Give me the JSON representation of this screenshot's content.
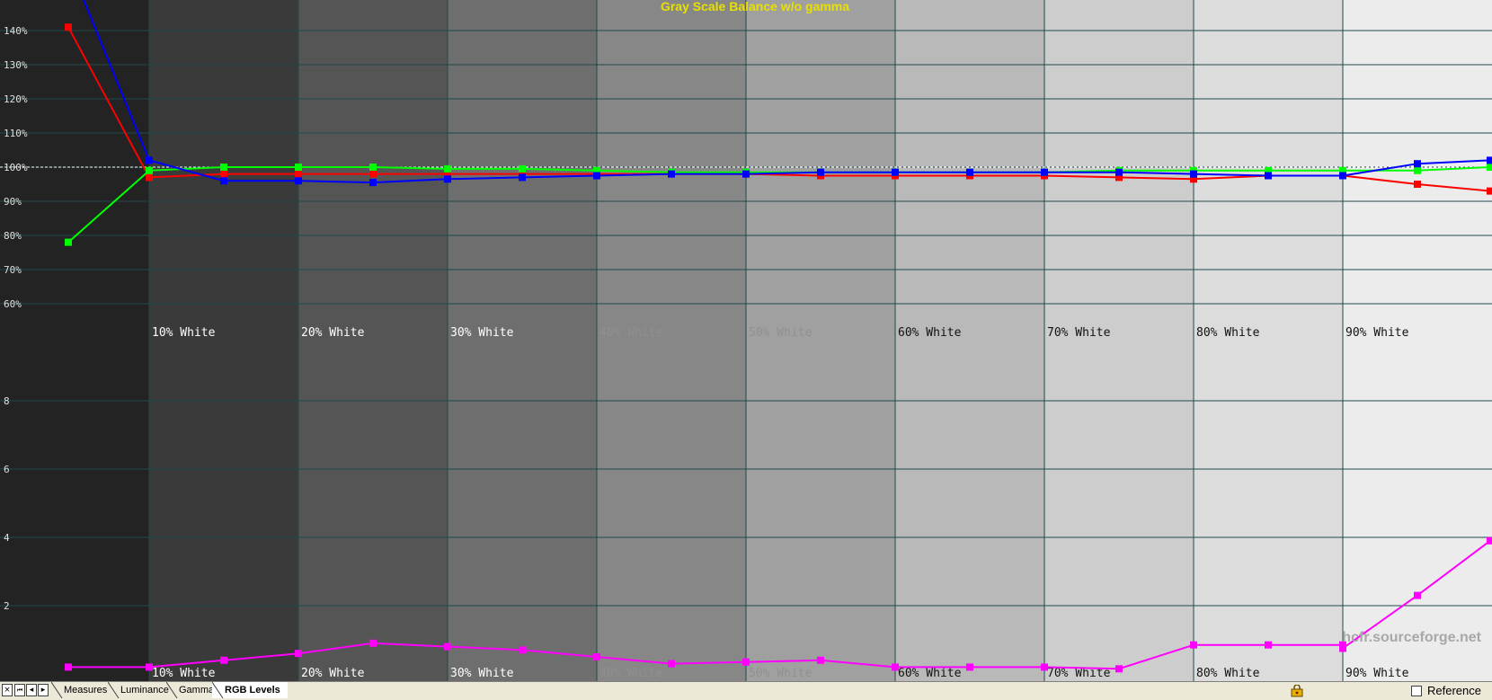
{
  "chart_data": {
    "type": "line",
    "title": "Gray Scale Balance w/o gamma",
    "x": [
      0,
      10,
      15,
      20,
      25,
      30,
      35,
      40,
      45,
      50,
      55,
      60,
      65,
      70,
      75,
      80,
      85,
      90,
      95,
      100
    ],
    "x_tick_labels": [
      "10% White",
      "20% White",
      "30% White",
      "40% White",
      "50% White",
      "60% White",
      "70% White",
      "80% White",
      "90% White"
    ],
    "upper_panel": {
      "y_tick_labels": [
        "60%",
        "70%",
        "80%",
        "90%",
        "100%",
        "110%",
        "120%",
        "130%",
        "140%"
      ],
      "ylim": [
        55,
        145
      ],
      "series": [
        {
          "color": "#ff0000",
          "values": [
            141,
            97,
            98,
            98,
            98,
            98,
            98,
            98,
            98,
            98,
            97.5,
            97.5,
            97.5,
            97.5,
            97,
            96.5,
            97.5,
            97.5,
            95,
            93
          ]
        },
        {
          "color": "#00ff00",
          "values": [
            78,
            99,
            100,
            100,
            100,
            99.5,
            99.5,
            99,
            98.5,
            98.5,
            98.5,
            98.5,
            98.5,
            98.5,
            99,
            99,
            99,
            99,
            99,
            100
          ]
        },
        {
          "color": "#0000ff",
          "values": [
            160,
            102,
            96,
            96,
            95.5,
            96.5,
            97,
            97.5,
            98,
            98,
            98.5,
            98.5,
            98.5,
            98.5,
            98.5,
            98,
            97.5,
            97.5,
            101,
            102
          ]
        }
      ]
    },
    "lower_panel": {
      "y_tick_labels": [
        "2",
        "4",
        "6",
        "8"
      ],
      "ylim": [
        0,
        10
      ],
      "series": [
        {
          "color": "#ff00ff",
          "values": [
            0.2,
            0.2,
            0.4,
            0.6,
            0.9,
            0.8,
            0.7,
            0.5,
            0.3,
            0.35,
            0.4,
            0.2,
            0.2,
            0.2,
            0.15,
            0.85,
            0.85,
            0.85,
            0.75,
            2.3,
            3.9
          ]
        }
      ]
    },
    "grid": true
  },
  "watermark": "hcfr.sourceforge.net",
  "tabs": [
    "Measures",
    "Luminance",
    "Gamma",
    "RGB Levels"
  ],
  "active_tab": "RGB Levels",
  "nav": {
    "close": "×",
    "first": "⏮",
    "prev": "◂",
    "next": "▸"
  },
  "reference_label": "Reference",
  "colors": {
    "title": "#e8e000",
    "grid": "#1f4a4a",
    "watermark": "#a8a8a8"
  }
}
